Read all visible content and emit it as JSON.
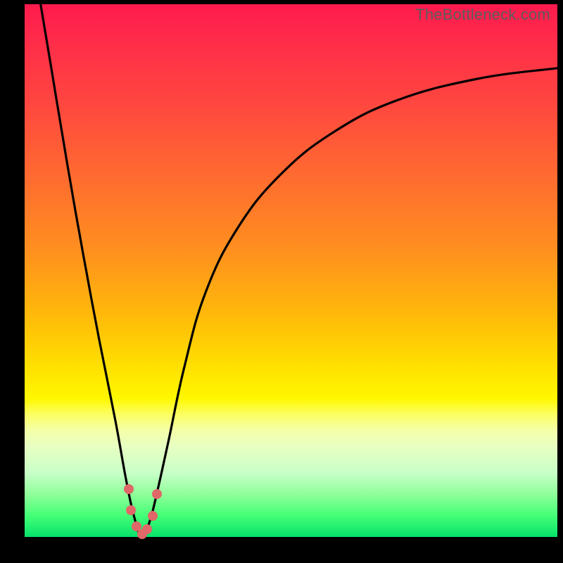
{
  "watermark": "TheBottleneck.com",
  "colors": {
    "frame": "#000000",
    "curve": "#000000",
    "dot": "#e06868",
    "gradient_top": "#ff1a4d",
    "gradient_mid": "#ffe000",
    "gradient_bottom": "#06e26a"
  },
  "chart_data": {
    "type": "line",
    "title": "",
    "xlabel": "",
    "ylabel": "",
    "xlim": [
      0,
      100
    ],
    "ylim": [
      0,
      100
    ],
    "grid": false,
    "legend": false,
    "series": [
      {
        "name": "bottleneck-curve",
        "notes": "V-shaped curve; values estimated from pixel positions (y: 0=bottom green, 100=top red). Minimum near x≈22.",
        "x": [
          3,
          5,
          8,
          11,
          14,
          17,
          19,
          20.5,
          22,
          23.5,
          25,
          27,
          30,
          34,
          40,
          48,
          58,
          70,
          85,
          100
        ],
        "y": [
          100,
          88,
          70,
          53,
          37,
          22,
          11,
          4,
          0,
          3,
          9,
          18,
          32,
          46,
          58,
          68,
          76,
          82,
          86,
          88
        ]
      }
    ],
    "markers": {
      "name": "highlight-dots",
      "notes": "Cluster of salmon dots near the curve minimum.",
      "points": [
        {
          "x": 19.5,
          "y": 9
        },
        {
          "x": 20.0,
          "y": 5
        },
        {
          "x": 21.0,
          "y": 2
        },
        {
          "x": 22.0,
          "y": 0.5
        },
        {
          "x": 23.0,
          "y": 1.5
        },
        {
          "x": 24.0,
          "y": 4
        },
        {
          "x": 24.8,
          "y": 8
        }
      ]
    }
  }
}
